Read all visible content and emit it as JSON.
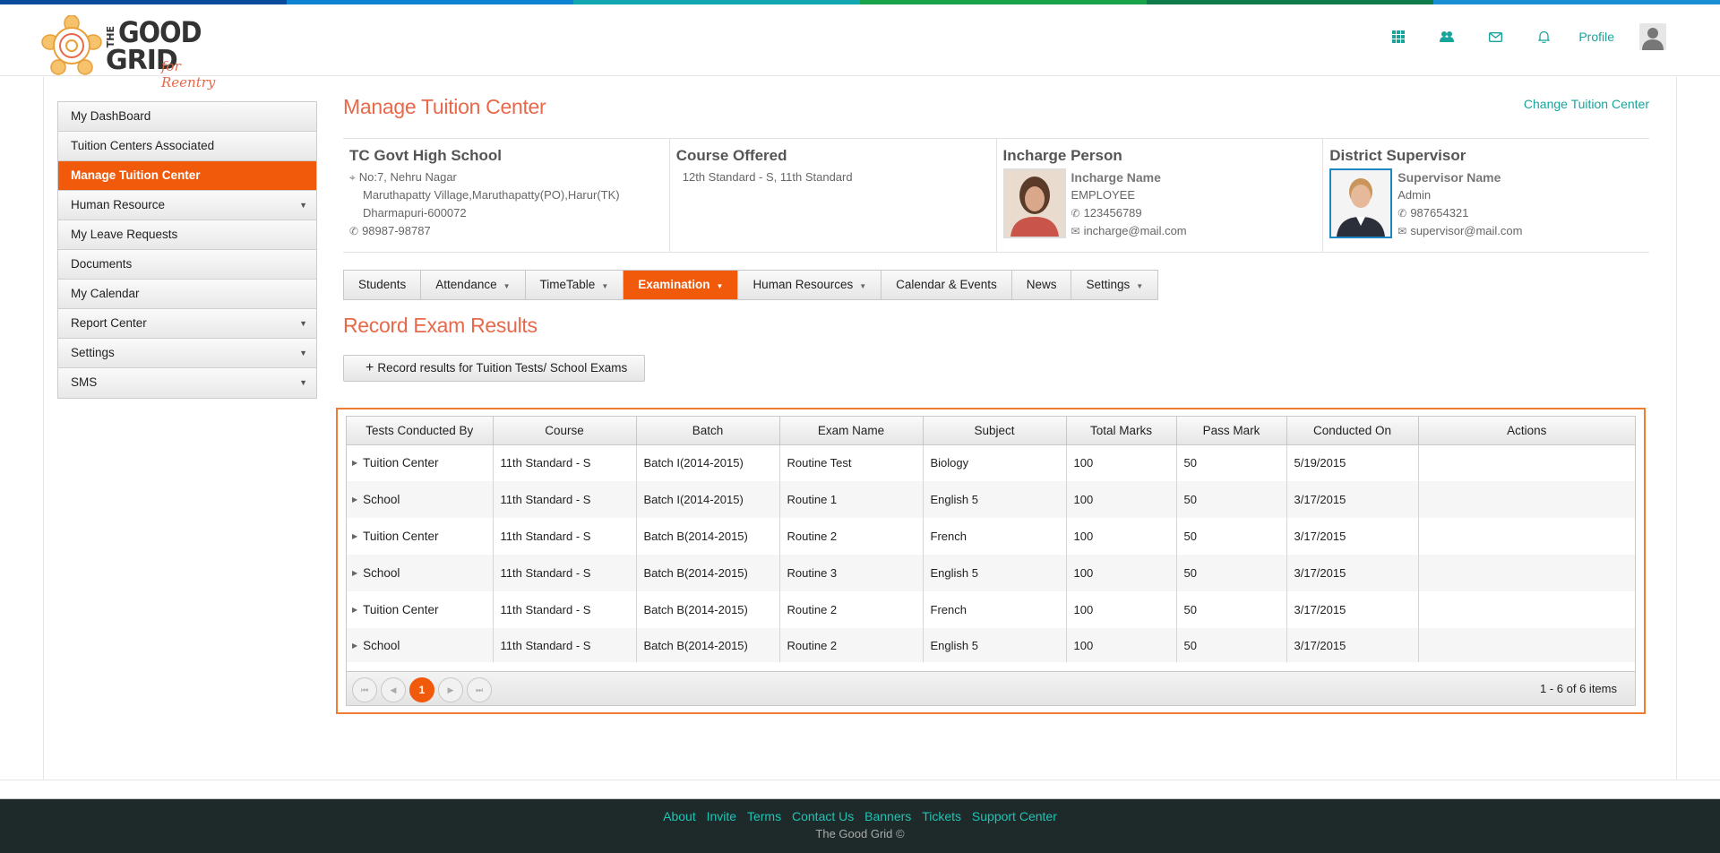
{
  "header": {
    "logo": {
      "the": "THE",
      "good": "GOOD",
      "grid": "GRID",
      "tagline": "for Reentry"
    },
    "icons": [
      "apps-grid-icon",
      "users-icon",
      "mail-icon",
      "bell-icon"
    ],
    "profile_label": "Profile"
  },
  "topbar_colors": [
    "#0a4b9c",
    "#0d83d2",
    "#12a6b0",
    "#16a34a",
    "#0f7a4a",
    "#1a8fd4"
  ],
  "sidebar": {
    "items": [
      {
        "label": "My DashBoard",
        "has_submenu": false
      },
      {
        "label": "Tuition Centers Associated",
        "has_submenu": false
      },
      {
        "label": "Manage Tuition Center",
        "has_submenu": false,
        "active": true
      },
      {
        "label": "Human Resource",
        "has_submenu": true
      },
      {
        "label": "My Leave Requests",
        "has_submenu": false
      },
      {
        "label": "Documents",
        "has_submenu": false
      },
      {
        "label": "My Calendar",
        "has_submenu": false
      },
      {
        "label": "Report Center",
        "has_submenu": true
      },
      {
        "label": "Settings",
        "has_submenu": true
      },
      {
        "label": "SMS",
        "has_submenu": true
      }
    ]
  },
  "main": {
    "title": "Manage Tuition Center",
    "change_link": "Change Tuition Center",
    "center": {
      "name": "TC Govt High School",
      "address1": "No:7, Nehru Nagar",
      "address2": "Maruthapatty Village,Maruthapatty(PO),Harur(TK)",
      "address3": "Dharmapuri-600072",
      "phone": "98987-98787"
    },
    "course": {
      "heading": "Course Offered",
      "value": "12th Standard - S, 11th Standard"
    },
    "incharge": {
      "heading": "Incharge Person",
      "name": "Incharge Name",
      "role": "EMPLOYEE",
      "phone": "123456789",
      "email": "incharge@mail.com"
    },
    "supervisor": {
      "heading": "District Supervisor",
      "name": "Supervisor Name",
      "role": "Admin",
      "phone": "987654321",
      "email": "supervisor@mail.com"
    },
    "tabs": [
      {
        "label": "Students",
        "caret": false
      },
      {
        "label": "Attendance",
        "caret": true
      },
      {
        "label": "TimeTable",
        "caret": true
      },
      {
        "label": "Examination",
        "caret": true,
        "active": true
      },
      {
        "label": "Human Resources",
        "caret": true
      },
      {
        "label": "Calendar & Events",
        "caret": false
      },
      {
        "label": "News",
        "caret": false
      },
      {
        "label": "Settings",
        "caret": true
      }
    ],
    "section_title": "Record Exam Results",
    "record_button": "Record results for Tuition Tests/ School Exams"
  },
  "grid": {
    "columns": [
      "Tests Conducted By",
      "Course",
      "Batch",
      "Exam Name",
      "Subject",
      "Total Marks",
      "Pass Mark",
      "Conducted On",
      "Actions"
    ],
    "rows": [
      [
        "Tuition Center",
        "11th Standard - S",
        "Batch I(2014-2015)",
        "Routine Test",
        "Biology",
        "100",
        "50",
        "5/19/2015",
        ""
      ],
      [
        "School",
        "11th Standard - S",
        "Batch I(2014-2015)",
        "Routine  1",
        "English 5",
        "100",
        "50",
        "3/17/2015",
        ""
      ],
      [
        "Tuition Center",
        "11th Standard - S",
        "Batch B(2014-2015)",
        "Routine 2",
        "French",
        "100",
        "50",
        "3/17/2015",
        ""
      ],
      [
        "School",
        "11th Standard - S",
        "Batch B(2014-2015)",
        "Routine  3",
        "English 5",
        "100",
        "50",
        "3/17/2015",
        ""
      ],
      [
        "Tuition Center",
        "11th Standard - S",
        "Batch B(2014-2015)",
        "Routine 2",
        "French",
        "100",
        "50",
        "3/17/2015",
        ""
      ],
      [
        "School",
        "11th Standard - S",
        "Batch B(2014-2015)",
        "Routine 2",
        "English 5",
        "100",
        "50",
        "3/17/2015",
        ""
      ]
    ],
    "pager": {
      "current_page": "1",
      "info": "1 - 6 of 6 items"
    }
  },
  "footer": {
    "links": [
      "About",
      "Invite",
      "Terms",
      "Contact Us",
      "Banners",
      "Tickets",
      "Support Center"
    ],
    "copyright": "The Good Grid ©"
  }
}
